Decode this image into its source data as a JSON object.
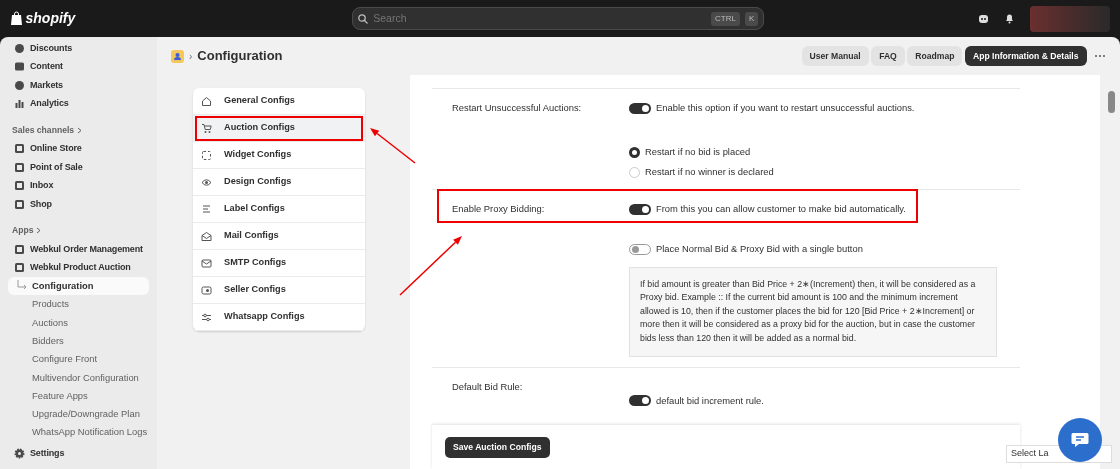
{
  "topbar": {
    "logo": "shopify",
    "search": {
      "placeholder": "Search",
      "keys": [
        "CTRL",
        "K"
      ]
    }
  },
  "sidebar": {
    "items": [
      {
        "label": "Discounts",
        "kind": "main"
      },
      {
        "label": "Content",
        "kind": "main"
      },
      {
        "label": "Markets",
        "kind": "main"
      },
      {
        "label": "Analytics",
        "kind": "main"
      },
      {
        "label": "Sales channels",
        "kind": "heading"
      },
      {
        "label": "Online Store",
        "kind": "main"
      },
      {
        "label": "Point of Sale",
        "kind": "main"
      },
      {
        "label": "Inbox",
        "kind": "main"
      },
      {
        "label": "Shop",
        "kind": "main"
      },
      {
        "label": "Apps",
        "kind": "heading"
      },
      {
        "label": "Webkul Order Management",
        "kind": "main"
      },
      {
        "label": "Webkul Product Auction",
        "kind": "main"
      },
      {
        "label": "Configuration",
        "kind": "sub",
        "selected": true
      },
      {
        "label": "Products",
        "kind": "sub",
        "selected": false
      },
      {
        "label": "Auctions",
        "kind": "sub",
        "selected": false
      },
      {
        "label": "Bidders",
        "kind": "sub",
        "selected": false
      },
      {
        "label": "Configure Front",
        "kind": "sub",
        "selected": false
      },
      {
        "label": "Multivendor Configuration",
        "kind": "sub",
        "selected": false
      },
      {
        "label": "Feature Apps",
        "kind": "sub",
        "selected": false
      },
      {
        "label": "Upgrade/Downgrade Plan",
        "kind": "sub",
        "selected": false
      },
      {
        "label": "WhatsApp Notification Logs",
        "kind": "sub",
        "selected": false
      }
    ],
    "settings": "Settings"
  },
  "header": {
    "separator": "›",
    "title": "Configuration",
    "buttons": [
      {
        "label": "User Manual",
        "primary": false
      },
      {
        "label": "FAQ",
        "primary": false
      },
      {
        "label": "Roadmap",
        "primary": false
      },
      {
        "label": "App Information & Details",
        "primary": true
      }
    ]
  },
  "config_nav": [
    {
      "label": "General Configs",
      "selected": false
    },
    {
      "label": "Auction Configs",
      "selected": true
    },
    {
      "label": "Widget Configs",
      "selected": false
    },
    {
      "label": "Design Configs",
      "selected": false
    },
    {
      "label": "Label Configs",
      "selected": false
    },
    {
      "label": "Mail Configs",
      "selected": false
    },
    {
      "label": "SMTP Configs",
      "selected": false
    },
    {
      "label": "Seller Configs",
      "selected": false
    },
    {
      "label": "Whatsapp Configs",
      "selected": false
    }
  ],
  "settings": [
    {
      "label": "Restart Unsuccessful Auctions:",
      "controls": [
        {
          "kind": "toggle",
          "on": true,
          "text": "Enable this option if you want to restart unsuccessful auctions."
        },
        {
          "kind": "radio",
          "selected": true,
          "text": "Restart if no bid is placed"
        },
        {
          "kind": "radio",
          "selected": false,
          "text": "Restart if no winner is declared"
        }
      ]
    },
    {
      "label": "Enable Proxy Bidding:",
      "controls": [
        {
          "kind": "toggle",
          "on": true,
          "text": "From this you can allow customer to make bid automatically."
        },
        {
          "kind": "toggle",
          "on": false,
          "text": "Place Normal Bid & Proxy Bid with a single button"
        },
        {
          "kind": "note",
          "text": "If bid amount is greater than Bid Price + 2∗(Increment) then, it will be considered as a Proxy bid. Example :: If the current bid amount is 100 and the minimum increment allowed is 10, then if the customer places the bid for 120 [Bid Price + 2∗Increment] or more then it will be considered as a proxy bid for the auction, but in case the customer bids less than 120 then it will be added as a normal bid."
        }
      ]
    },
    {
      "label": "Default Bid Rule:",
      "controls": [
        {
          "kind": "toggle",
          "on": true,
          "text": "default bid increment rule."
        }
      ]
    }
  ],
  "save_button": "Save Auction Configs",
  "language_widget": "Select La"
}
